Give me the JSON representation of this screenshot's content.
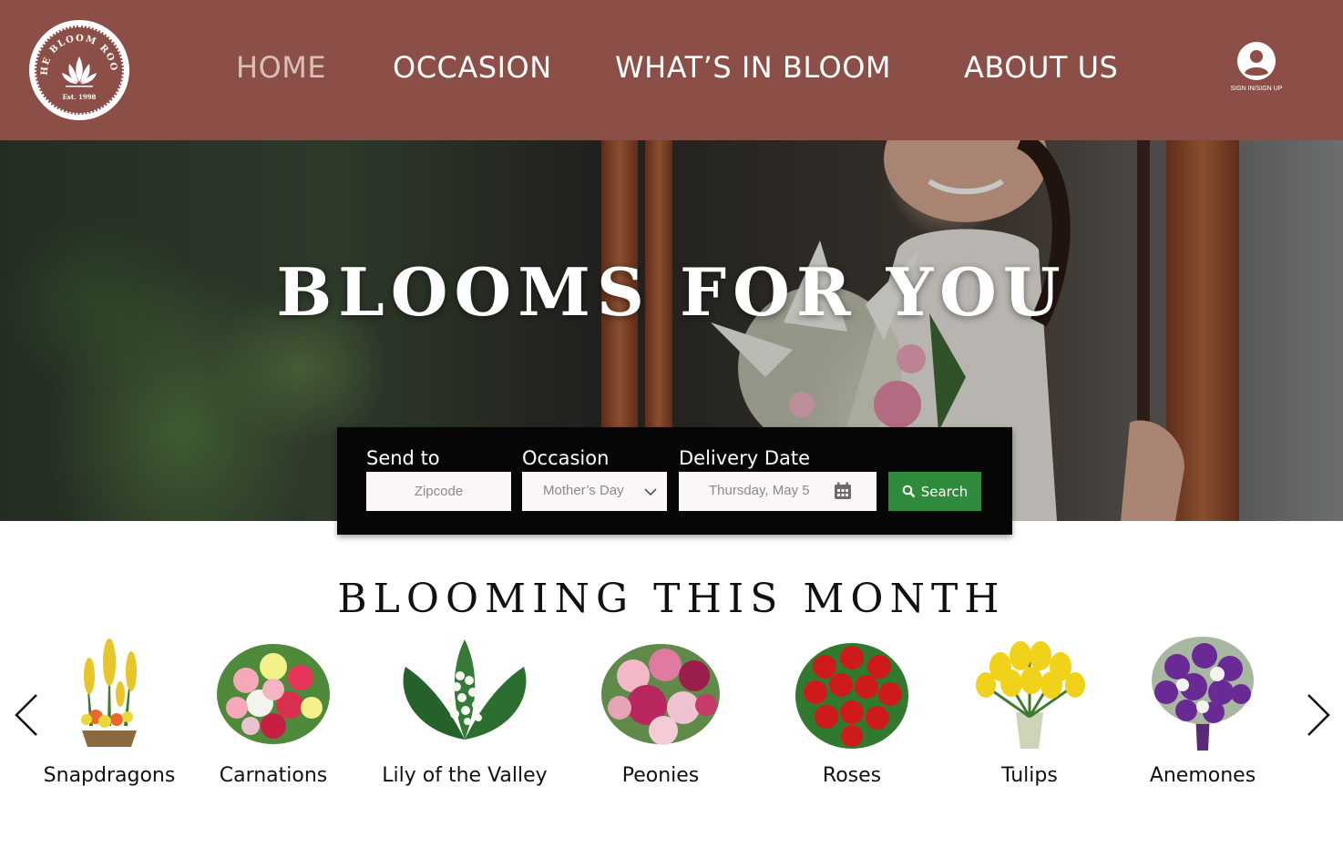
{
  "brand": {
    "logo_text": "THE BLOOM ROOM",
    "logo_est": "Est. 1998",
    "header_color": "#8b4f48"
  },
  "nav": {
    "items": [
      {
        "label": "HOME",
        "active": true
      },
      {
        "label": "OCCASION",
        "active": false
      },
      {
        "label": "WHAT’S IN BLOOM",
        "active": false
      },
      {
        "label": "ABOUT US",
        "active": false
      }
    ],
    "account_label": "SIGN IN/SIGN UP",
    "account_icon": "user-circle-icon"
  },
  "hero": {
    "title": "BLOOMS FOR YOU"
  },
  "search": {
    "send_to_label": "Send to",
    "zipcode_placeholder": "Zipcode",
    "occasion_label": "Occasion",
    "occasion_value": "Mother’s Day",
    "delivery_label": "Delivery Date",
    "delivery_value": "Thursday, May 5",
    "button_label": "Search",
    "button_color": "#2e8b3b",
    "button_icon": "search-icon"
  },
  "blooming": {
    "title": "BLOOMING THIS MONTH",
    "prev_icon": "chevron-left-icon",
    "next_icon": "chevron-right-icon",
    "flowers": [
      {
        "name": "Snapdragons",
        "color": "#e7c42a"
      },
      {
        "name": "Carnations",
        "color": "#d8304f"
      },
      {
        "name": "Lily of the Valley",
        "color": "#f4f4ee"
      },
      {
        "name": "Peonies",
        "color": "#b8285e"
      },
      {
        "name": "Roses",
        "color": "#cf1a1c"
      },
      {
        "name": "Tulips",
        "color": "#f1d21a"
      },
      {
        "name": "Anemones",
        "color": "#6a2a96"
      }
    ]
  }
}
